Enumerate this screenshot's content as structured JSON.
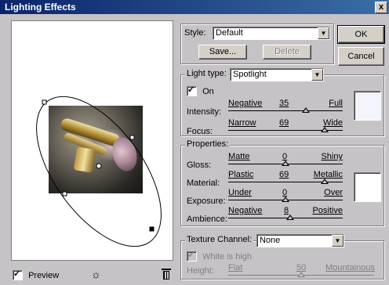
{
  "window": {
    "title": "Lighting Effects",
    "close_glyph": "x"
  },
  "preview": {
    "checkbox_label": "Preview",
    "checked": true
  },
  "style": {
    "label": "Style:",
    "value": "Default",
    "save_label": "Save...",
    "delete_label": "Delete"
  },
  "dialog_buttons": {
    "ok_label": "OK",
    "cancel_label": "Cancel"
  },
  "light_type": {
    "legend": "Light type:",
    "value": "Spotlight",
    "on_label": "On",
    "on_checked": true,
    "sliders": [
      {
        "label": "Intensity:",
        "left": "Negative",
        "value": "35",
        "right": "Full",
        "level": 0.675
      },
      {
        "label": "Focus:",
        "left": "Narrow",
        "value": "69",
        "right": "Wide",
        "level": 0.845
      }
    ],
    "color_swatch": "#f4f4fc"
  },
  "properties": {
    "legend": "Properties:",
    "sliders": [
      {
        "label": "Gloss:",
        "left": "Matte",
        "value": "0",
        "right": "Shiny",
        "level": 0.5
      },
      {
        "label": "Material:",
        "left": "Plastic",
        "value": "69",
        "right": "Metallic",
        "level": 0.845
      },
      {
        "label": "Exposure:",
        "left": "Under",
        "value": "0",
        "right": "Over",
        "level": 0.5
      },
      {
        "label": "Ambience:",
        "left": "Negative",
        "value": "8",
        "right": "Positive",
        "level": 0.54
      }
    ],
    "color_swatch": "#ffffff"
  },
  "texture": {
    "label": "Texture Channel:",
    "value": "None",
    "white_is_high_label": "White is high",
    "white_is_high_checked": true,
    "height": {
      "label": "Height:",
      "left": "Flat",
      "value": "50",
      "right": "Mountainous",
      "level": 0.5
    }
  },
  "icons": {
    "light_bulb": "light-bulb-icon",
    "trash": "trash-icon",
    "dropdown": "chevron-down-icon"
  }
}
